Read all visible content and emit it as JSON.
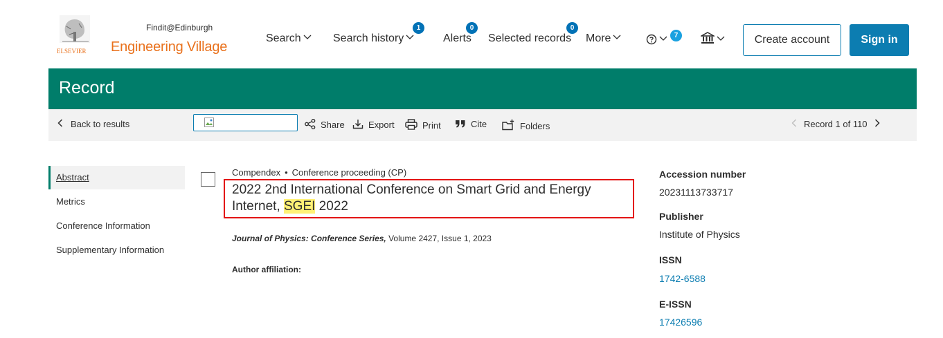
{
  "header": {
    "logo_text": "ELSEVIER",
    "brand": "Engineering Village",
    "nav": [
      {
        "label": "Search"
      },
      {
        "label": "Search history",
        "badge": "1"
      },
      {
        "label": "Alerts",
        "badge": "0"
      },
      {
        "label": "Selected records",
        "badge": "0"
      },
      {
        "label": "More"
      }
    ],
    "help_badge": "7",
    "create_account": "Create account",
    "sign_in": "Sign in"
  },
  "page_title": "Record",
  "toolbar": {
    "back": "Back to results",
    "findit": "Findit@Edinburgh",
    "share": "Share",
    "export": "Export",
    "print": "Print",
    "cite": "Cite",
    "folders": "Folders",
    "record_count": "Record 1 of 110"
  },
  "sidenav": [
    {
      "label": "Abstract"
    },
    {
      "label": "Metrics"
    },
    {
      "label": "Conference Information"
    },
    {
      "label": "Supplementary Information"
    }
  ],
  "record": {
    "database": "Compendex",
    "doc_type": "Conference proceeding (CP)",
    "title_before": "2022 2nd International Conference on Smart Grid and Energy Internet, ",
    "title_highlight": "SGEI",
    "title_after": " 2022",
    "journal": "Journal of Physics: Conference Series,",
    "journal_rest": " Volume 2427, Issue 1, 2023",
    "author_affiliation_label": "Author affiliation:"
  },
  "details": {
    "accession_label": "Accession number",
    "accession_value": "20231113733717",
    "publisher_label": "Publisher",
    "publisher_value": "Institute of Physics",
    "issn_label": "ISSN",
    "issn_value": "1742-6588",
    "eissn_label": "E-ISSN",
    "eissn_value": "17426596"
  },
  "colors": {
    "brand_orange": "#e9711c",
    "green_bar": "#007d6a",
    "primary_blue": "#0c7db1",
    "highlight": "#fff176",
    "annotation_red": "#e31414"
  }
}
